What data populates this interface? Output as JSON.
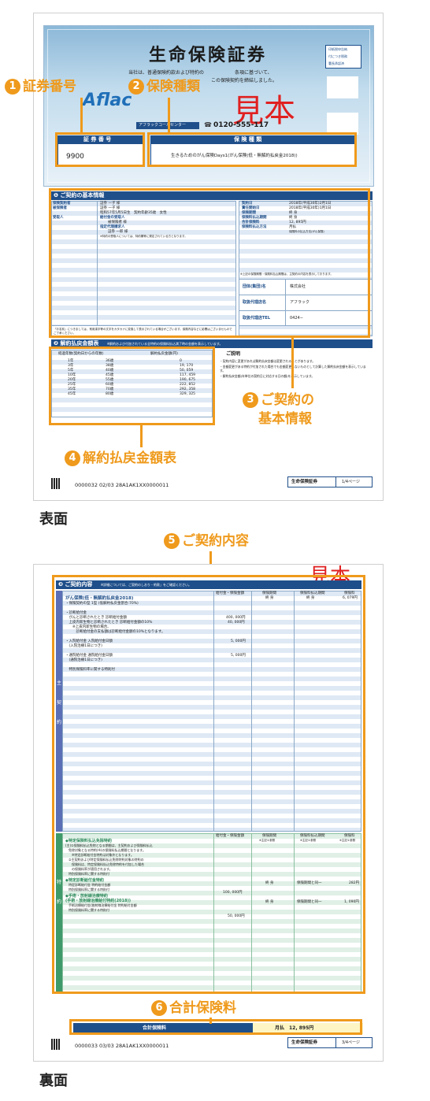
{
  "front": {
    "title": "生命保険証券",
    "intro_lines": [
      "当社は、普通保険約款および特約の",
      "条項に基づいて、",
      "この保険契約を締結しました。"
    ],
    "stamp_lines": [
      "印紙税申告納",
      "付につき税務",
      "署長承認済"
    ],
    "watermark": "見本",
    "brand": "Aflac",
    "call_center_label": "アフラックコールセンター",
    "phone": "0120-555-117",
    "policy_number_header": "証 券 番 号",
    "policy_number": "9900",
    "insurance_type_header": "保 険 種 類",
    "insurance_type": "生きるためのがん保険Days1(がん保険(低・無解約払戻金2018))",
    "sec1_title": "❶ ご契約の基本情報",
    "left_labels": [
      "保険契約者",
      "被保険者",
      "",
      "受取人",
      "",
      "",
      "",
      ""
    ],
    "left_values": [
      "証券 一子 様",
      "証券 一子 様",
      "昭和57年5月5日生　契約年齢35歳　女性",
      "給付金の受取人",
      "被保険者 様",
      "指定代理請求人",
      "証券 一郎 様",
      "※特約の受取人については、特約欄等に規定されている方となります。"
    ],
    "left_note": "「お名前」につきましては、常用漢字等の文字をカタカナに変換して表示されている場合がございます。保険内容などに影響はございませんのでご了承ください。",
    "right_labels": [
      "契約日",
      "責任開始日",
      "保険期間",
      "保険料払込期間",
      "合計保険料",
      "保険料払込方法"
    ],
    "right_values": [
      "2018年(平成30年)2月1日",
      "2018年(平成30年)1月1日",
      "終 身",
      "終 身",
      "12, 895円",
      "月払"
    ],
    "right_extra": "保険料の払込方法(がん保険)",
    "right_note": "※上記の保険期間・保険料払込期間は、主契約の内容を表示しております。",
    "agent_labels": [
      "団体(集団)名",
      "取扱代理店名",
      "取扱代理店TEL"
    ],
    "agent_values": [
      "株式会社",
      "アフラック",
      "0424−"
    ],
    "sec2_title": "❷ 解約払戻金額表",
    "sec2_note": "※解約および付加されている全特約の保険料払込満了時の金額を表示しています。",
    "table_headers": [
      "経過年数(契約日からの年数)",
      "",
      "解約払戻金額(円)"
    ],
    "table_rows": [
      [
        "1年",
        "36歳",
        "0"
      ],
      [
        "3年",
        "38歳",
        "19, 170"
      ],
      [
        "5年",
        "40歳",
        "50, 059"
      ],
      [
        "10年",
        "45歳",
        "117, 459"
      ],
      [
        "20年",
        "55歳",
        "190, 675"
      ],
      [
        "25年",
        "60歳",
        "222, 852"
      ],
      [
        "35年",
        "70歳",
        "292, 358"
      ],
      [
        "45年",
        "80歳",
        "329, 325"
      ]
    ],
    "explain_title": "ご説明",
    "explain_lines": [
      "・契約内容に変更があれば解約払戻金額は変更されることがあります。",
      "・金額変更がある特約が付加された場合でも金額変更しないものとして計算した解約払戻金額を表示しています。",
      "・解約払戻金額(年単位の契約日に対応する日の額)を表示しています。"
    ],
    "footer_code": "0000032 02/03 28A1AK1XX0000011",
    "footer_label": "生命保険証券",
    "footer_page": "1/4ページ"
  },
  "callouts": {
    "c1": {
      "num": "1",
      "text": "証券番号"
    },
    "c2": {
      "num": "2",
      "text": "保険種類"
    },
    "c3": {
      "num": "3",
      "text": "ご契約の",
      "text2": "基本情報"
    },
    "c4": {
      "num": "4",
      "text": "解約払戻金額表"
    },
    "c5": {
      "num": "5",
      "text": "ご契約内容"
    },
    "c6": {
      "num": "6",
      "text": "合計保険料"
    }
  },
  "labels": {
    "front": "表面",
    "back": "裏面"
  },
  "back": {
    "watermark": "見本",
    "sec3_title": "❸ ご契約内容",
    "sec3_note": "※詳細については、ご契約のしおり・約款」をご確認ください。",
    "col_headers": [
      "給付金・保険金額",
      "保険期間",
      "保険料払込期間",
      "保険料"
    ],
    "main_title": "がん保険(低・無解約払戻金2018)",
    "main_period": "終 身",
    "main_pay": "終 身",
    "main_premium": "6, 079円",
    "main_lines": [
      "・保険契約の型 1型 (低解約払戻金割合:70%)",
      "",
      "・診断給付金",
      "　がんと診断されたとき 診断給付金額",
      "　上皮内新生物と診断されたとき 診断給付金額の10%",
      "　　※上皮内新生物の場合、",
      "　　　診断給付金の支払額は診断給付金額の10%となります。",
      "",
      "・入院給付金 入院給付金日額",
      "　(入院治療1日につき)",
      "",
      "・通院給付金 通院給付金日額",
      "　(通院治療1日につき)",
      "",
      "　特別保険料率に関する特則付"
    ],
    "main_amounts": [
      "400, 000円",
      "40, 000円",
      "5, 000円",
      "5, 000円"
    ],
    "side_main": [
      "主",
      "契",
      "約"
    ],
    "rider_col_headers": [
      "給付金・保険金額",
      "保険期間",
      "保険料払込期間",
      "保険料"
    ],
    "rider_col_notes": [
      "※主記①参照",
      "※主記①参照",
      "※主記①参照"
    ],
    "riders": [
      {
        "title": "◆特定保険料払込免除特約",
        "lines": [
          "(主)①保険料払込免除となる期間は、主契約および保険料払込",
          "　免除対象となる特約(※)の保険料払込期間となります。",
          "　　※特定診断給付金特約は対象外となります。",
          "　②主契約および特定保険料払込免除特約対象の特約の",
          "　　保険料は、特定保険料払込免除特約を付加した場合",
          "　　の保険料率が適用されます。",
          "　特別保険料率に関する特則付"
        ]
      },
      {
        "title": "◆特定診断給付金特約",
        "lines": [
          "　特定診断給付金 特約給付金額",
          "　特別保険料率に関する特則付"
        ],
        "amount": "100, 000円",
        "period": "終 身",
        "pay": "保険期間と同一",
        "premium": "282円"
      },
      {
        "title": "◆手術・放射線治療特約",
        "title2": "(手術・放射線治療給付特約(2018))",
        "lines": [
          "　手術治療給付金/放射線治療給付金 特約給付金額",
          "　特別保険料率に関する特則付"
        ],
        "amount": "50, 000円",
        "period": "終 身",
        "pay": "保険期間と同一",
        "premium": "1, 090円"
      }
    ],
    "side_rider": [
      "特",
      "約"
    ],
    "total_label": "合計保険料",
    "total_value": "月払　12, 895円",
    "footer_code": "0000033 03/03 28A1AK1XX0000011",
    "footer_label": "生命保険証券",
    "footer_page": "3/4ページ"
  },
  "colors": {
    "accent": "#ef9a1c",
    "navy": "#1f4f8a",
    "watermark": "#e02020"
  }
}
